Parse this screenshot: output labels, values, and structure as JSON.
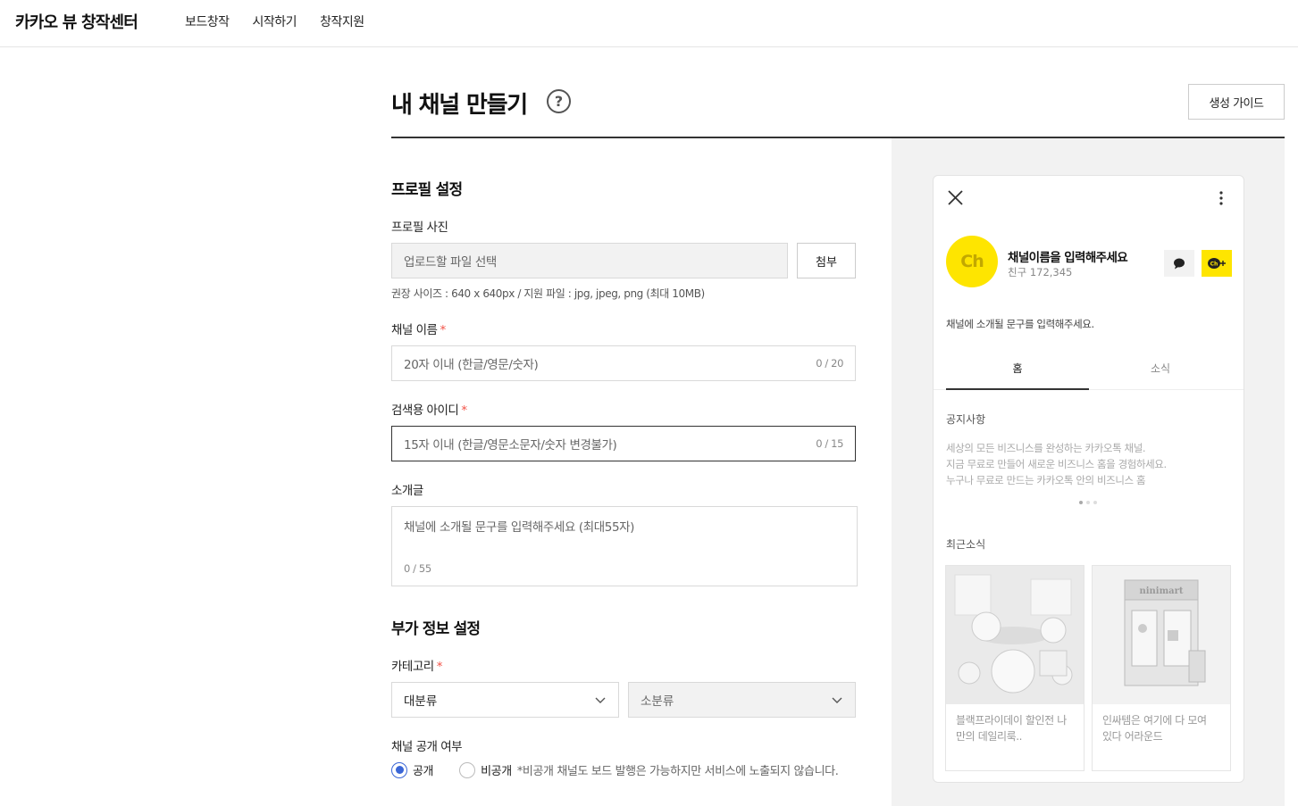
{
  "header": {
    "logo": "카카오 뷰 창작센터",
    "menu": [
      "보드창작",
      "시작하기",
      "창작지원"
    ]
  },
  "page": {
    "title": "내 채널 만들기",
    "help": "?",
    "guide_button": "생성 가이드"
  },
  "profile": {
    "section_title": "프로필 설정",
    "photo_label": "프로필 사진",
    "photo_placeholder": "업로드할 파일 선택",
    "attach_button": "첨부",
    "photo_hint": "권장 사이즈 : 640 x 640px / 지원 파일 : jpg, jpeg, png (최대 10MB)",
    "name_label": "채널 이름",
    "name_placeholder": "20자 이내 (한글/영문/숫자)",
    "name_count": "0 / 20",
    "id_label": "검색용 아이디",
    "id_placeholder": "15자 이내 (한글/영문소문자/숫자 변경불가)",
    "id_count": "0 / 15",
    "intro_label": "소개글",
    "intro_placeholder": "채널에 소개될 문구를 입력해주세요 (최대55자)",
    "intro_count": "0 / 55",
    "required_mark": "*"
  },
  "extra": {
    "section_title": "부가 정보 설정",
    "category_label": "카테고리",
    "category_major": "대분류",
    "category_minor": "소분류",
    "visibility_label": "채널 공개 여부",
    "public_label": "공개",
    "private_label": "비공개",
    "private_note": "*비공개 채널도 보드 발행은 가능하지만 서비스에 노출되지 않습니다.",
    "selected": "public"
  },
  "preview": {
    "avatar_text": "Ch",
    "channel_name": "채널이름을 입력해주세요",
    "friends": "친구 172,345",
    "description": "채널에 소개될 문구를 입력해주세요.",
    "tabs": [
      "홈",
      "소식"
    ],
    "notice_title": "공지사항",
    "notice_lines": [
      "세상의 모든 비즈니스를 완성하는 카카오톡 채널.",
      "지금 무료로 만들어 새로운 비즈니스 홈을 경험하세요.",
      "누구나 무료로 만드는 카카오톡 안의 비즈니스 홈"
    ],
    "recent_title": "최근소식",
    "cards": [
      {
        "line1": "블랙프라이데이 할인전 나",
        "line2": "만의 데일리룩.."
      },
      {
        "line1": "인싸템은 여기에 다 모여",
        "line2": "있다 어라운드",
        "sign": "ninimart"
      }
    ]
  },
  "colors": {
    "accent_yellow": "#fee500",
    "radio_blue": "#3a66d6",
    "required_red": "#f25247"
  }
}
